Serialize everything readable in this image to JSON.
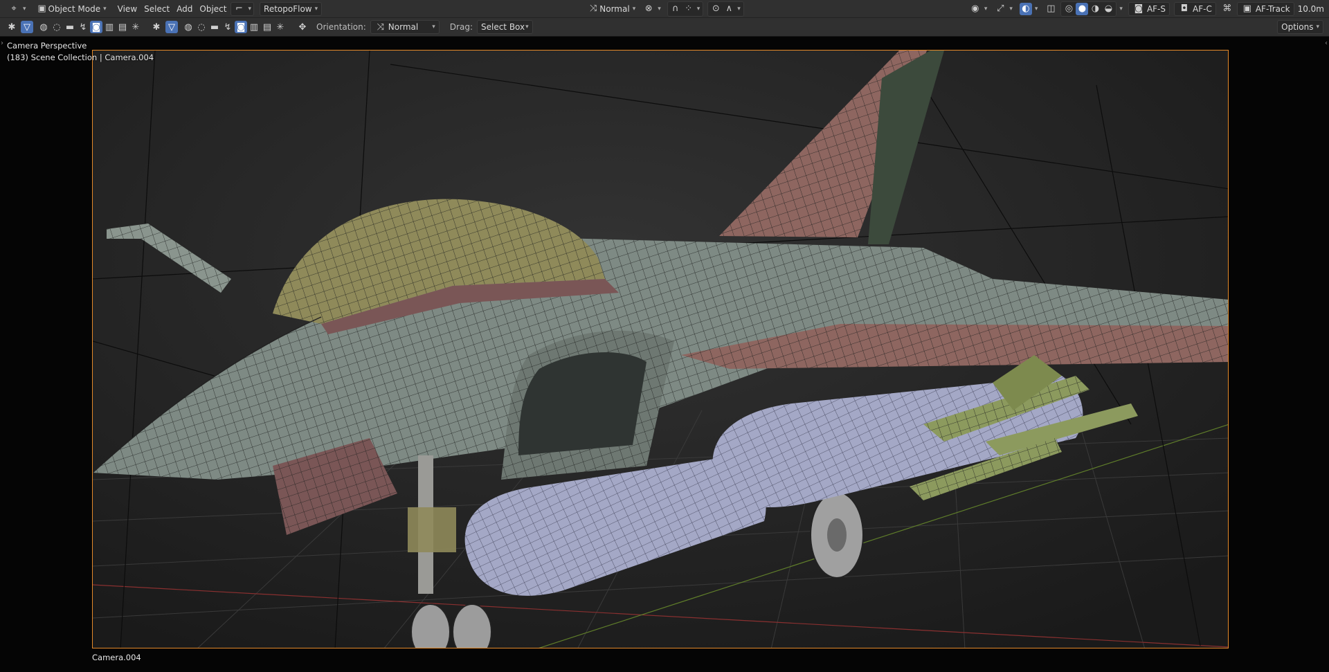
{
  "header": {
    "editor_type_icon": "editor-type-icon",
    "mode": "Object Mode",
    "menus": [
      "View",
      "Select",
      "Add",
      "Object"
    ],
    "addon_menu": "RetopoFlow",
    "transform_orientation": "Normal",
    "right_tools": {
      "af_s": "AF-S",
      "af_c": "AF-C",
      "af_track": "AF-Track",
      "distance": "10.0m"
    }
  },
  "tool_header": {
    "orientation_label": "Orientation:",
    "orientation_value": "Normal",
    "drag_label": "Drag:",
    "drag_value": "Select Box",
    "options": "Options"
  },
  "viewport": {
    "perspective": "Camera Perspective",
    "collection": "(183) Scene Collection | Camera.004",
    "camera_name": "Camera.004",
    "colors": {
      "camera_frame": "#e58a2a",
      "fuselage": "#7e8a84",
      "canopy": "#8f8a5a",
      "tail": "#8e6660",
      "tanks": "#a4a8c6",
      "missiles": "#8c9a5e"
    }
  }
}
